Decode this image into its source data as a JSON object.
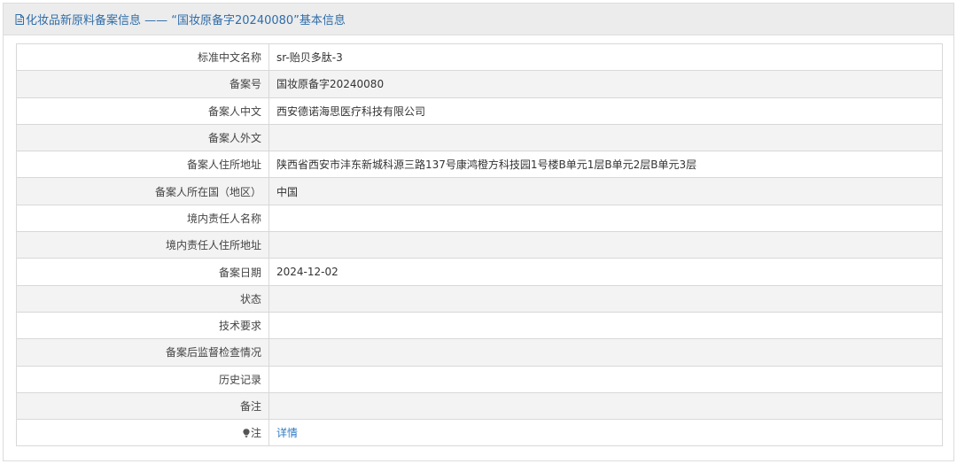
{
  "header": {
    "title": "化妆品新原料备案信息 —— “国妆原备字20240080”基本信息",
    "icon": "document-icon"
  },
  "rows": [
    {
      "label": "标准中文名称",
      "value": "sr-贻贝多肽-3"
    },
    {
      "label": "备案号",
      "value": "国妆原备字20240080"
    },
    {
      "label": "备案人中文",
      "value": "西安德诺海思医疗科技有限公司"
    },
    {
      "label": "备案人外文",
      "value": ""
    },
    {
      "label": "备案人住所地址",
      "value": "陕西省西安市沣东新城科源三路137号康鸿橙方科技园1号楼B单元1层B单元2层B单元3层"
    },
    {
      "label": "备案人所在国（地区）",
      "value": "中国"
    },
    {
      "label": "境内责任人名称",
      "value": ""
    },
    {
      "label": "境内责任人住所地址",
      "value": ""
    },
    {
      "label": "备案日期",
      "value": "2024-12-02"
    },
    {
      "label": "状态",
      "value": ""
    },
    {
      "label": "技术要求",
      "value": ""
    },
    {
      "label": "备案后监督检查情况",
      "value": ""
    },
    {
      "label": "历史记录",
      "value": ""
    },
    {
      "label": "备注",
      "value": ""
    }
  ],
  "note": {
    "label": "注",
    "icon": "lightbulb-icon",
    "link_text": "详情"
  },
  "colors": {
    "title": "#2f6da9",
    "link": "#2f7bc4",
    "header_bg": "#ececec",
    "stripe": "#f3f3f3"
  }
}
